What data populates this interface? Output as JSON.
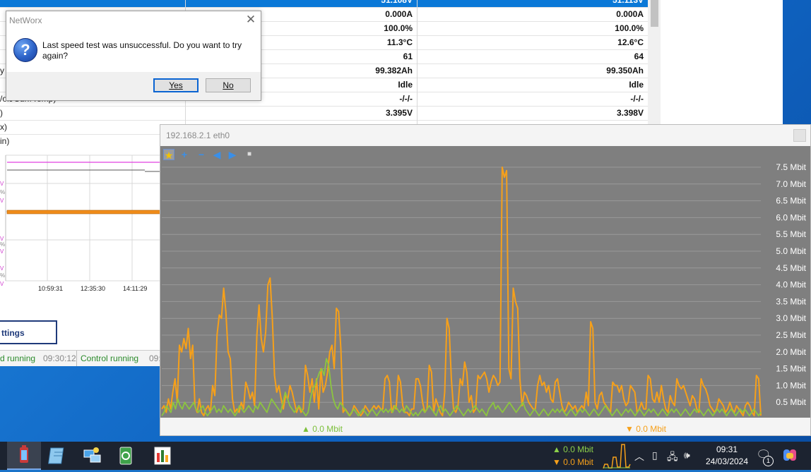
{
  "dialog": {
    "title": "NetWorx",
    "message": "Last speed test was unsuccessful. Do you want to try again?",
    "yes_label": "Yes",
    "no_label": "No"
  },
  "battery_table": {
    "rows": [
      {
        "label": "",
        "v1": "51.108V",
        "v2": "51.113V",
        "selected": true
      },
      {
        "label": "",
        "v1": "0.000A",
        "v2": "0.000A"
      },
      {
        "label": "",
        "v1": "100.0%",
        "v2": "100.0%"
      },
      {
        "label": "",
        "v1": "11.3°C",
        "v2": "12.6°C"
      },
      {
        "label": "",
        "v1": "61",
        "v2": "64"
      },
      {
        "label": "y",
        "v1": "99.382Ah",
        "v2": "99.350Ah"
      },
      {
        "label": "",
        "v1": "Idle",
        "v2": "Idle"
      },
      {
        "label": "/olt/Curr/Temp)",
        "v1": "-/-/-",
        "v2": "-/-/-"
      },
      {
        "label": ")",
        "v1": "3.395V",
        "v2": "3.398V"
      },
      {
        "label": "x)",
        "v1": "",
        "v2": ""
      },
      {
        "label": "in)",
        "v1": "",
        "v2": ""
      }
    ]
  },
  "mini_chart": {
    "times": [
      "10:59:31",
      "12:35:30",
      "14:11:29"
    ],
    "axis_letters": [
      "V",
      "%",
      "V",
      "V",
      "%",
      "V",
      "V",
      "%",
      "V"
    ]
  },
  "settings_label": "ttings",
  "status": {
    "left_text": "d running",
    "left_time": "09:30:12",
    "right_text": "Control running",
    "right_time": "09:"
  },
  "graph": {
    "title": "192.168.2.1 eth0",
    "up_label": "▲ 0.0 Mbit",
    "down_label": "▼ 0.0 Mbit",
    "colors": {
      "download": "#f6a01a",
      "upload": "#8cc63f",
      "background": "#7f7f7f",
      "grid": "#9a9a9a"
    },
    "toolbar_icons": [
      "star-icon",
      "zoom-in-icon",
      "zoom-out-icon",
      "back-icon",
      "forward-icon",
      "lock-icon"
    ]
  },
  "chart_data": {
    "type": "line",
    "ylim": [
      0,
      7.5
    ],
    "yticks": [
      "0.5 Mbit",
      "1.0 Mbit",
      "1.5 Mbit",
      "2.0 Mbit",
      "2.5 Mbit",
      "3.0 Mbit",
      "3.5 Mbit",
      "4.0 Mbit",
      "4.5 Mbit",
      "5.0 Mbit",
      "5.5 Mbit",
      "6.0 Mbit",
      "6.5 Mbit",
      "7.0 Mbit",
      "7.5 Mbit"
    ],
    "series": [
      {
        "values": [
          0.3,
          0.4,
          0.2,
          0.6,
          0.3,
          0.8,
          1.2,
          0.5,
          2.2,
          2.0,
          2.4,
          2.1,
          2.7,
          1.8,
          2.2,
          0.4,
          0.2,
          0.6,
          0.2,
          0.1,
          0.3,
          0.4,
          0.2,
          1.0,
          0.7,
          2.5,
          3.1,
          3.0,
          3.9,
          3.2,
          2.0,
          1.8,
          0.6,
          0.2,
          0.3,
          0.2,
          0.5,
          0.3,
          1.1,
          0.9,
          0.6,
          0.8,
          0.4,
          2.5,
          3.4,
          2.4,
          2.0,
          2.6,
          4.0,
          4.2,
          3.0,
          1.3,
          0.8,
          1.0,
          0.6,
          0.3,
          0.7,
          0.6,
          1.0,
          0.8,
          0.5,
          0.2,
          0.4,
          0.2,
          0.3,
          1.6,
          1.3,
          0.8,
          1.2,
          0.5,
          1.2,
          0.3,
          1.5,
          0.8,
          1.0,
          1.4,
          2.0,
          2.2,
          1.5,
          3.3,
          3.2,
          2.1,
          0.2,
          0.3,
          0.2,
          0.1,
          0.2,
          0.4,
          0.3,
          0.2,
          0.1,
          0.2,
          0.4,
          0.3,
          0.2,
          0.3,
          0.4,
          0.3,
          0.4,
          0.3,
          0.3,
          1.2,
          1.3,
          1.1,
          0.2,
          0.4,
          0.3,
          1.3,
          1.1,
          0.4,
          0.2,
          0.2,
          0.1,
          0.3,
          0.3,
          1.2,
          1.2,
          1.0,
          0.5,
          0.2,
          0.3,
          1.6,
          1.4,
          0.2,
          0.6,
          0.4,
          0.2,
          0.1,
          0.8,
          3.0,
          2.7,
          1.2,
          0.3,
          0.2,
          0.4,
          1.2,
          1.0,
          1.7,
          1.4,
          0.5,
          0.7,
          0.2,
          0.3,
          1.3,
          1.2,
          1.3,
          1.4,
          1.2,
          0.8,
          1.1,
          1.3,
          1.2,
          1.0,
          1.1,
          7.5,
          7.2,
          7.4,
          1.5,
          1.2,
          3.9,
          3.5,
          3.3,
          1.2,
          0.4,
          0.8,
          0.7,
          0.5,
          0.4,
          0.3,
          0.3,
          1.0,
          1.3,
          1.0,
          1.1,
          0.8,
          1.0,
          0.6,
          0.5,
          1.1,
          1.2,
          0.8,
          0.4,
          0.2,
          0.3,
          0.5,
          0.4,
          0.3,
          0.4,
          0.2,
          0.3,
          0.4,
          0.3,
          0.8,
          0.4,
          2.9,
          2.7,
          0.5,
          0.3,
          0.7,
          0.8,
          0.5,
          0.4,
          0.3,
          0.2,
          1.1,
          1.0,
          1.0,
          0.8,
          1.0,
          0.6,
          0.4,
          0.5,
          1.0,
          0.9,
          0.8,
          0.2,
          0.3,
          0.5,
          0.3,
          0.3,
          1.3,
          1.2,
          0.6,
          0.5,
          0.8,
          0.5,
          1.0,
          0.6,
          0.3,
          0.2,
          0.7,
          0.5,
          0.4,
          1.2,
          1.0,
          0.9,
          1.0,
          0.8,
          0.6,
          0.4,
          0.7,
          0.6,
          0.3,
          0.2,
          1.2,
          1.0,
          0.9,
          0.7,
          0.4,
          0.3,
          0.2,
          0.3,
          0.6,
          0.5,
          0.4,
          0.2,
          0.3,
          0.5,
          0.3,
          0.2,
          0.4,
          0.3,
          0.2,
          0.1,
          0.4,
          0.5,
          0.4,
          0.2,
          0.1,
          1.3,
          1.2,
          0.1
        ]
      },
      {
        "values": [
          0.1,
          0.2,
          0.4,
          0.3,
          0.2,
          0.5,
          0.3,
          0.6,
          0.4,
          0.3,
          0.5,
          0.4,
          0.3,
          0.4,
          0.5,
          0.3,
          0.2,
          0.3,
          0.4,
          0.2,
          0.1,
          0.2,
          0.3,
          0.4,
          0.2,
          0.3,
          0.2,
          0.4,
          0.3,
          0.2,
          0.3,
          0.2,
          0.1,
          0.2,
          0.4,
          0.3,
          0.2,
          0.3,
          0.4,
          0.3,
          0.2,
          0.4,
          0.3,
          0.5,
          0.4,
          0.3,
          0.2,
          0.4,
          0.6,
          0.5,
          0.4,
          0.3,
          0.2,
          0.5,
          0.8,
          0.6,
          0.4,
          0.3,
          0.2,
          0.3,
          0.4,
          0.3,
          0.2,
          0.1,
          0.2,
          0.6,
          0.9,
          1.0,
          1.2,
          1.4,
          1.5,
          1.3,
          1.8,
          1.6,
          1.0,
          0.6,
          0.4,
          0.3,
          0.5,
          0.4,
          0.3,
          0.2,
          0.1,
          0.2,
          0.3,
          0.2,
          0.1,
          0.2,
          0.3,
          0.2,
          0.1,
          0.2,
          0.3,
          0.2,
          0.1,
          0.2,
          0.3,
          0.2,
          0.3,
          0.2,
          0.3,
          0.2,
          0.4,
          0.3,
          0.2,
          0.3,
          0.2,
          0.4,
          0.3,
          0.2,
          0.1,
          0.2,
          0.1,
          0.2,
          0.3,
          0.2,
          0.3,
          0.4,
          0.3,
          0.2,
          0.1,
          0.3,
          0.4,
          0.2,
          0.3,
          0.2,
          0.1,
          0.2,
          0.3,
          0.4,
          0.3,
          0.2,
          0.1,
          0.2,
          0.3,
          0.2,
          0.3,
          0.4,
          0.3,
          0.2,
          0.3,
          0.2,
          0.1,
          0.3,
          0.4,
          0.5,
          0.3,
          0.4,
          0.3,
          0.2,
          0.3,
          0.4,
          0.5,
          0.4,
          0.3,
          0.2,
          0.3,
          0.4,
          0.5,
          0.3,
          0.2,
          0.1,
          0.2,
          0.3,
          0.2,
          0.1,
          0.2,
          0.3,
          0.2,
          0.1,
          0.2,
          0.3,
          0.2,
          0.3,
          0.2,
          0.3,
          0.2,
          0.1,
          0.2,
          0.3,
          0.2,
          0.1,
          0.2,
          0.3,
          0.2,
          0.3,
          0.2,
          0.1,
          0.2,
          0.3,
          0.2,
          0.1,
          0.2,
          0.3,
          0.4,
          0.3,
          0.2,
          0.1,
          0.2,
          0.3,
          0.2,
          0.1,
          0.2,
          0.3,
          0.2,
          0.3,
          0.2,
          0.1,
          0.2,
          0.3,
          0.2,
          0.1,
          0.2,
          0.3,
          0.2,
          0.3,
          0.2,
          0.1,
          0.2,
          0.3,
          0.2,
          0.1,
          0.2,
          0.3,
          0.2,
          0.3,
          0.2,
          0.1,
          0.2,
          0.3,
          0.2,
          0.1,
          0.2,
          0.3,
          0.2,
          0.3,
          0.2,
          0.1,
          0.2,
          0.3,
          0.2,
          0.1,
          0.2,
          0.3,
          0.2,
          0.3,
          0.2,
          0.1,
          0.2,
          0.3,
          0.2,
          0.1,
          0.2,
          0.3,
          0.2,
          0.3,
          0.2,
          0.1,
          0.2,
          0.3,
          0.2,
          0.1,
          0.2
        ]
      }
    ]
  },
  "taskbar": {
    "apps": [
      "battery-app-icon",
      "notepad-icon",
      "network-app-icon",
      "recycle-icon",
      "networx-icon"
    ],
    "tray_up": "▲ 0.0 Mbit",
    "tray_down": "▼ 0.0 Mbit",
    "time": "09:31",
    "date": "24/03/2024",
    "notification_count": "1"
  }
}
